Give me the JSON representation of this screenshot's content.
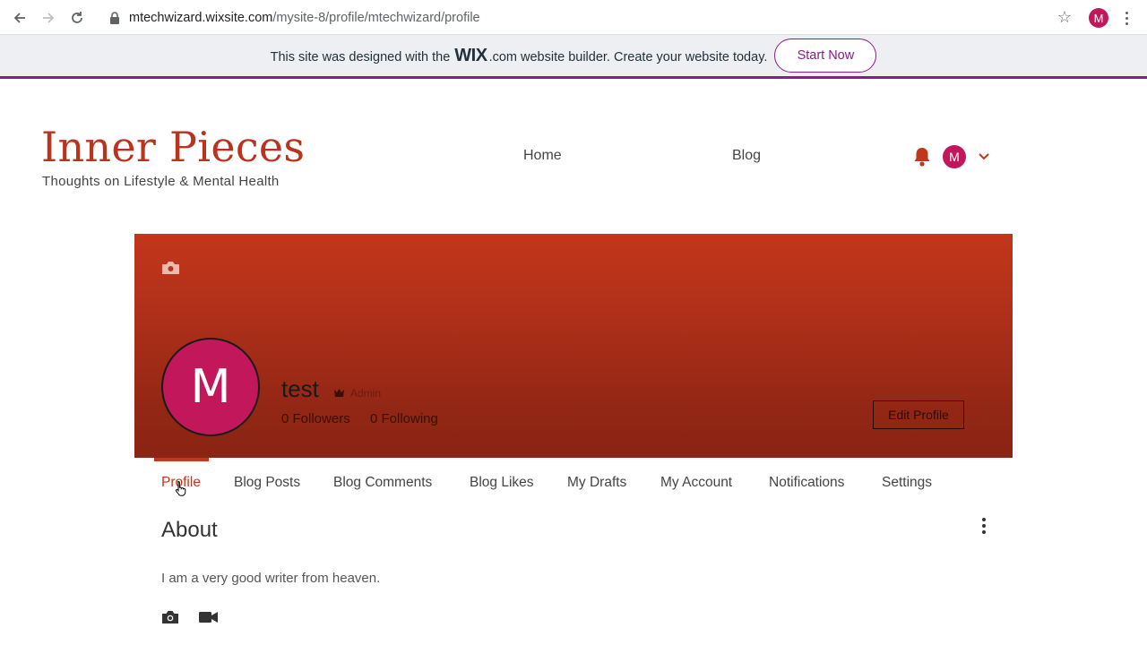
{
  "browser": {
    "url_host": "mtechwizard.wixsite.com",
    "url_path": "/mysite-8/profile/mtechwizard/profile",
    "profile_initial": "M"
  },
  "wix_banner": {
    "text_before": "This site was designed with the",
    "logo_text": "WIX",
    "text_after": ".com website builder. Create your website today.",
    "cta_label": "Start Now",
    "accent": "#8c1a8a"
  },
  "site": {
    "title": "Inner Pieces",
    "tagline": "Thoughts on Lifestyle & Mental Health",
    "nav": [
      "Home",
      "Blog"
    ],
    "user_initial": "M",
    "brand_color": "#b8341e"
  },
  "profile": {
    "avatar_initial": "M",
    "name": "test",
    "role": "Admin",
    "followers": "0 Followers",
    "following": "0 Following",
    "edit_label": "Edit Profile"
  },
  "tabs": [
    "Profile",
    "Blog Posts",
    "Blog Comments",
    "Blog Likes",
    "My Drafts",
    "My Account",
    "Notifications",
    "Settings"
  ],
  "active_tab": "Profile",
  "about": {
    "title": "About",
    "text": "I am a very good writer from heaven."
  }
}
